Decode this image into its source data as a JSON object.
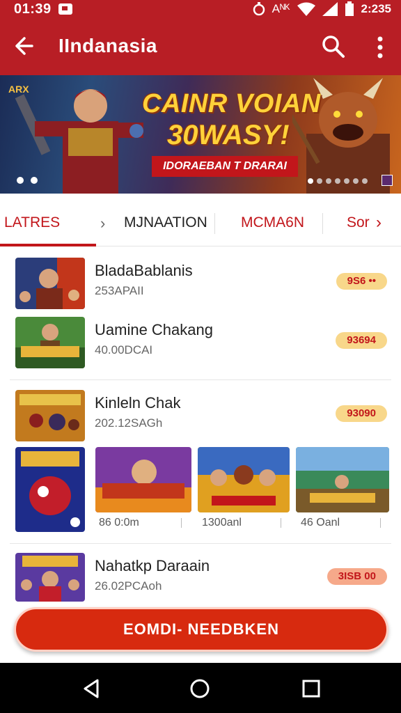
{
  "status_bar": {
    "time": "01:39",
    "right_text": "Aᴺᴷ",
    "battery": "2:235"
  },
  "app_bar": {
    "title": "IIndanasia"
  },
  "banner": {
    "corner_tag": "ARX",
    "headline_line1": "CAINR VOIAN",
    "headline_line2": "30WASY!",
    "subtitle": "IDORAEBAN T DRARAI"
  },
  "tabs": [
    {
      "label": "LATRES"
    },
    {
      "label": "MJNAATION"
    },
    {
      "label": "MCMA6N"
    },
    {
      "label": "Sor"
    }
  ],
  "games": [
    {
      "title": "BladaBablanis",
      "subtitle": "253APAII",
      "price": "9S6 ••"
    },
    {
      "title": "Uamine Chakang",
      "subtitle": "40.00DCAI",
      "price": "93694"
    },
    {
      "title": "Kinleln Chak",
      "subtitle": "202.12SAGh",
      "price": "93090"
    },
    {
      "title": "Nahatkp Daraain",
      "subtitle": "26.02PCAoh",
      "price": "3ISB 00"
    }
  ],
  "cards": [
    {
      "label": "86 0:0m"
    },
    {
      "label": "1300anl"
    },
    {
      "label": "46 Oanl"
    }
  ],
  "cta": {
    "label": "EOMDI- NEEDBKEN"
  },
  "colors": {
    "brand_red": "#b81e25",
    "accent_red": "#c2161b",
    "cta_red": "#d72a0f",
    "pill_yellow": "#f8d78a"
  }
}
